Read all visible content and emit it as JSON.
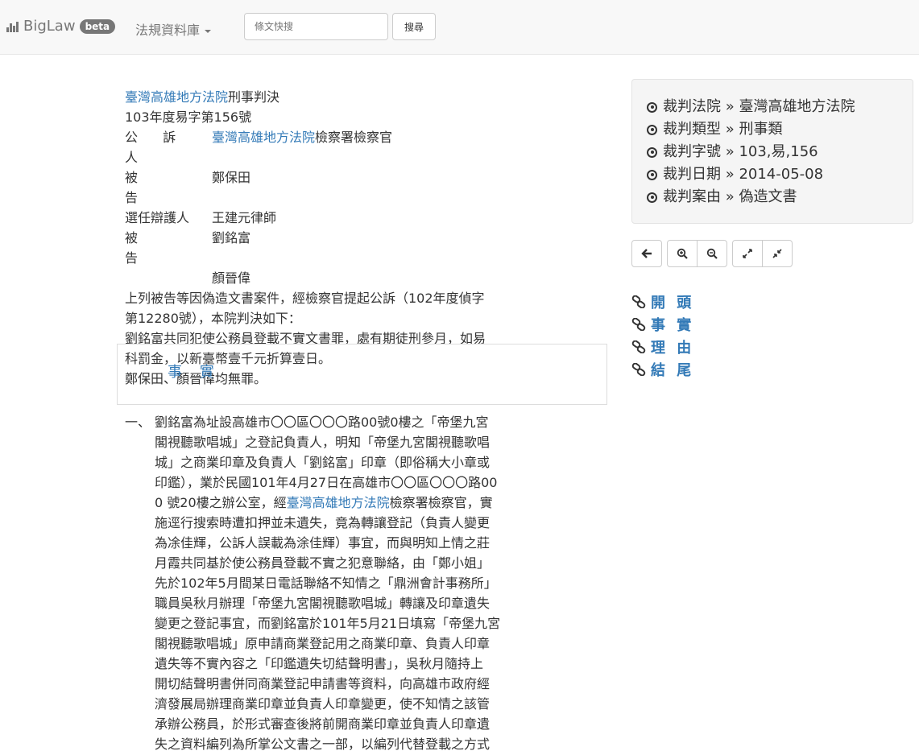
{
  "navbar": {
    "brand": "BigLaw",
    "badge": "beta",
    "menu_label": "法規資料庫",
    "search_placeholder": "條文快搜",
    "search_button": "搜尋"
  },
  "document": {
    "court_link": "臺灣高雄地方法院",
    "title_suffix": "刑事判決",
    "case_number": "103年度易字第156號",
    "parties": [
      {
        "label": "公 訴 人",
        "value_link": "臺灣高雄地方法院",
        "value_text": "檢察署檢察官"
      },
      {
        "label": "被 告",
        "value_link": "",
        "value_text": "鄭保田"
      },
      {
        "label": "選任辯護人",
        "value_link": "",
        "value_text": "王建元律師"
      },
      {
        "label": "被 告",
        "value_link": "",
        "value_text": "劉銘富"
      },
      {
        "label": "",
        "value_link": "",
        "value_text": "顏晉偉"
      }
    ],
    "intro_1": "上列被告等因偽造文書案件，經檢察官提起公訴（102年度偵字",
    "intro_2": "第12280號），本院判決如下：",
    "verdict_1": "劉銘富共同犯使公務員登載不實文書罪，處有期徒刑參月，如易",
    "verdict_2": "科罰金，以新臺幣壹千元折算壹日。",
    "verdict_3": "鄭保田、顏晉偉均無罪。"
  },
  "facts_section": {
    "title": "事 實"
  },
  "facts": {
    "number": "一、",
    "lines": [
      "劉銘富為址設高雄市〇〇區〇〇〇路00號0樓之「帝堡九宮",
      "閣視聽歌唱城」之登記負責人，明知「帝堡九宮閣視聽歌唱",
      "城」之商業印章及負責人「劉銘富」印章（即俗稱大小章或",
      "印鑑），業於民國101年4月27日在高雄市〇〇區〇〇〇路00",
      "0 號20樓之辦公室，經",
      "施逕行搜索時遭扣押並未遺失，竟為轉讓登記（負責人變更",
      "為凃佳輝，公訴人誤載為涂佳輝）事宜，而與明知上情之莊",
      "月霞共同基於使公務員登載不實之犯意聯絡，由「鄭小姐」",
      "先於102年5月間某日電話聯絡不知情之「鼎洲會計事務所」",
      "職員吳秋月辦理「帝堡九宮閣視聽歌唱城」轉讓及印章遺失",
      "變更之登記事宜，而劉銘富於101年5月21日填寫「帝堡九宮",
      "閣視聽歌唱城」原申請商業登記用之商業印章、負責人印章",
      "遺失等不實內容之「印鑑遺失切結聲明書」，吳秋月隨持上",
      "開切結聲明書併同商業登記申請書等資料，向高雄市政府經",
      "濟發展局辦理商業印章並負責人印章變更，使不知情之該管",
      "承辦公務員，於形式審查後將前開商業印章並負責人印章遺",
      "失之資料編列為所掌公文書之一部，以編列代替登載之方式"
    ],
    "line5_link": "臺灣高雄地方法院",
    "line5_tail": "檢察署檢察官，實"
  },
  "info": {
    "items": [
      "裁判法院 » 臺灣高雄地方法院",
      "裁判類型 » 刑事類",
      "裁判字號 » 103,易,156",
      "裁判日期 » 2014-05-08",
      "裁判案由 » 偽造文書"
    ]
  },
  "toolbar": {
    "icons": [
      "arrow-left-icon",
      "zoom-in-icon",
      "zoom-out-icon",
      "expand-icon",
      "compress-icon"
    ]
  },
  "toc": {
    "items": [
      "開 頭",
      "事 實",
      "理 由",
      "結 尾"
    ]
  }
}
